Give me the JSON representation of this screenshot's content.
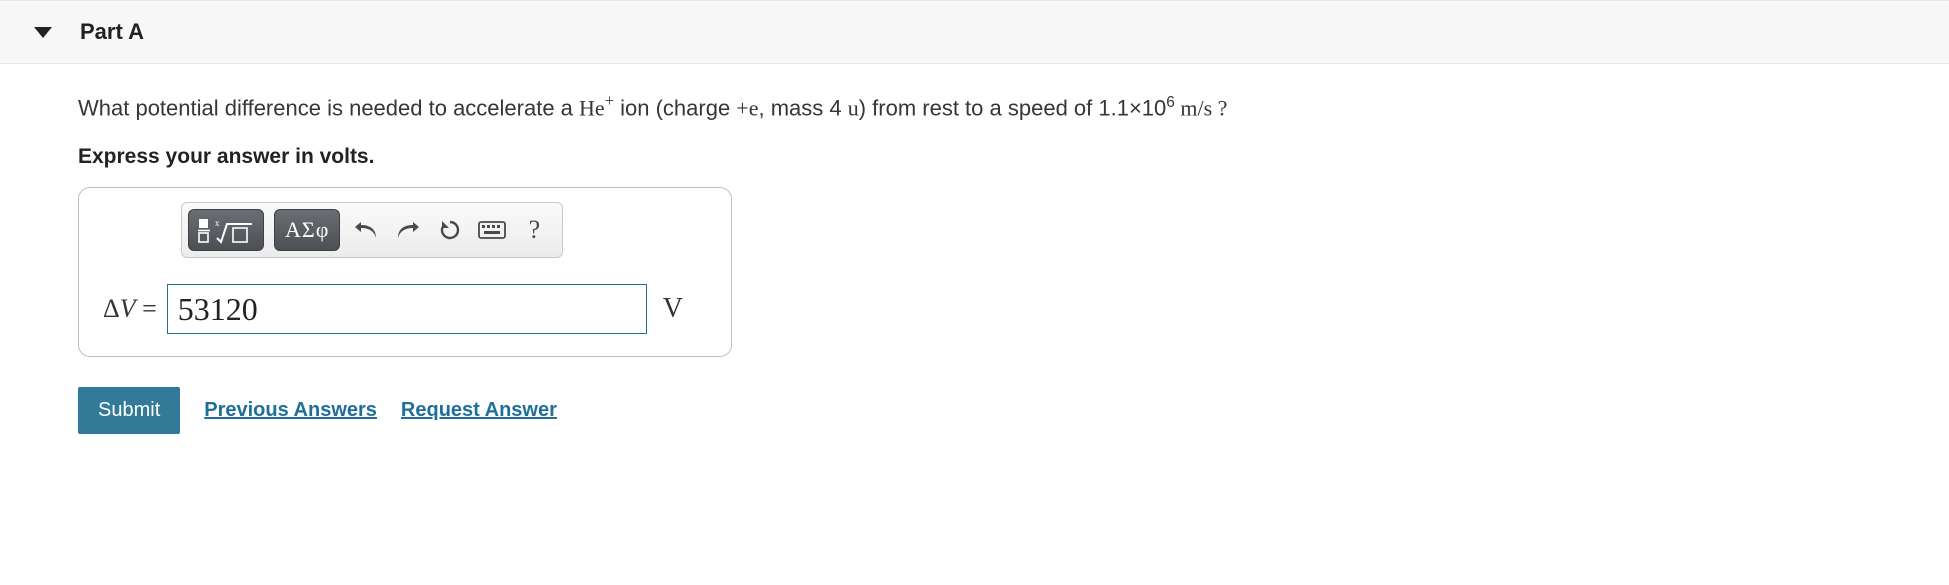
{
  "part": {
    "label": "Part A"
  },
  "question": {
    "pre": "What potential difference is needed to accelerate a ",
    "ion": "He",
    "ion_sup": "+",
    "mid1": " ion (charge ",
    "charge": "+e",
    "mid2": ", mass 4 ",
    "mass_unit": "u",
    "mid3": ") from rest to a speed of 1.1×10",
    "exp": "6",
    "tail_unit": "  m/s ?"
  },
  "instruction": "Express your answer in volts.",
  "toolbar": {
    "greek_label": "ΑΣφ",
    "help_label": "?"
  },
  "answer": {
    "prefix": "ΔV = ",
    "value": "53120",
    "unit": "V"
  },
  "actions": {
    "submit": "Submit",
    "previous": "Previous Answers",
    "request": "Request Answer"
  }
}
